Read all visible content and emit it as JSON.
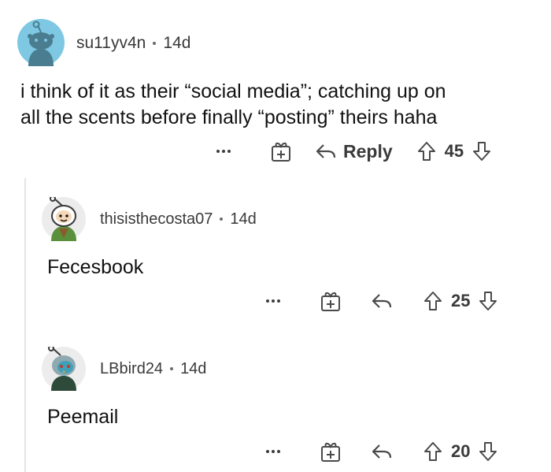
{
  "comments": [
    {
      "username": "su11yv4n",
      "age": "14d",
      "body_line1": "i think of it as their “social media”; catching up on",
      "body_line2": "all the scents before finally “posting” theirs haha",
      "more_icon": "more-dots-icon",
      "award_icon": "gift-award-icon",
      "reply_label": "Reply",
      "score": "45"
    },
    {
      "username": "thisisthecosta07",
      "age": "14d",
      "body": "Fecesbook",
      "score": "25"
    },
    {
      "username": "LBbird24",
      "age": "14d",
      "body": "Peemail",
      "score": "20"
    }
  ],
  "colors": {
    "avatar1_bg": "#7ec8e3",
    "avatar2_bg": "#e8e8e8",
    "avatar3_bg": "#e8e8e8",
    "thread_line": "#e4e4e4",
    "text": "#111111",
    "meta_text": "#3a3a3a"
  }
}
